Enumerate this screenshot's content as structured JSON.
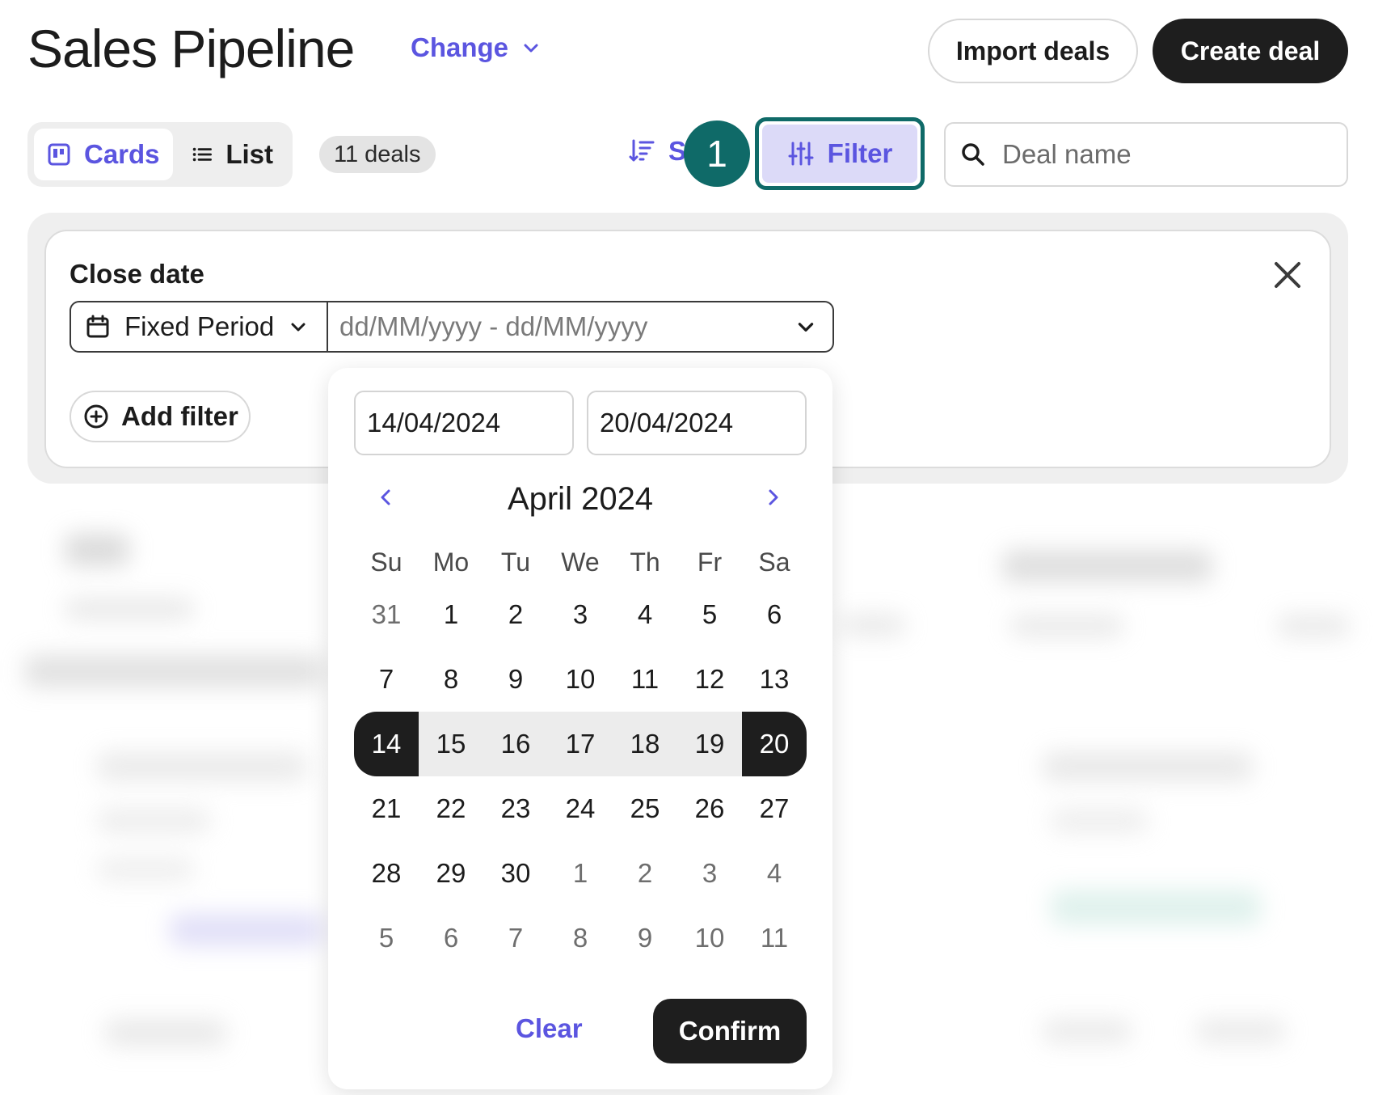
{
  "header": {
    "title": "Sales Pipeline",
    "change_label": "Change",
    "import_label": "Import deals",
    "create_label": "Create deal"
  },
  "toolbar": {
    "views": [
      {
        "label": "Cards",
        "icon": "cards-icon",
        "active": true
      },
      {
        "label": "List",
        "icon": "list-icon",
        "active": false
      }
    ],
    "deals_count": "11 deals",
    "sort_label": "S",
    "step_badge": "1",
    "filter_label": "Filter",
    "search_placeholder": "Deal name"
  },
  "filter_panel": {
    "label": "Close date",
    "period": "Fixed Period",
    "range_placeholder": "dd/MM/yyyy - dd/MM/yyyy",
    "add_filter_label": "Add filter"
  },
  "date_picker": {
    "start_value": "14/04/2024",
    "end_value": "20/04/2024",
    "month_title": "April 2024",
    "weekdays": [
      "Su",
      "Mo",
      "Tu",
      "We",
      "Th",
      "Fr",
      "Sa"
    ],
    "weeks": [
      [
        {
          "d": "31",
          "m": true
        },
        {
          "d": "1"
        },
        {
          "d": "2"
        },
        {
          "d": "3"
        },
        {
          "d": "4"
        },
        {
          "d": "5"
        },
        {
          "d": "6"
        }
      ],
      [
        {
          "d": "7"
        },
        {
          "d": "8"
        },
        {
          "d": "9"
        },
        {
          "d": "10"
        },
        {
          "d": "11"
        },
        {
          "d": "12"
        },
        {
          "d": "13"
        }
      ],
      [
        {
          "d": "14",
          "s": "start"
        },
        {
          "d": "15",
          "s": "in"
        },
        {
          "d": "16",
          "s": "in"
        },
        {
          "d": "17",
          "s": "in"
        },
        {
          "d": "18",
          "s": "in"
        },
        {
          "d": "19",
          "s": "in"
        },
        {
          "d": "20",
          "s": "end"
        }
      ],
      [
        {
          "d": "21"
        },
        {
          "d": "22"
        },
        {
          "d": "23"
        },
        {
          "d": "24"
        },
        {
          "d": "25"
        },
        {
          "d": "26"
        },
        {
          "d": "27"
        }
      ],
      [
        {
          "d": "28"
        },
        {
          "d": "29"
        },
        {
          "d": "30"
        },
        {
          "d": "1",
          "m": true
        },
        {
          "d": "2",
          "m": true
        },
        {
          "d": "3",
          "m": true
        },
        {
          "d": "4",
          "m": true
        }
      ],
      [
        {
          "d": "5",
          "m": true
        },
        {
          "d": "6",
          "m": true
        },
        {
          "d": "7",
          "m": true
        },
        {
          "d": "8",
          "m": true
        },
        {
          "d": "9",
          "m": true
        },
        {
          "d": "10",
          "m": true
        },
        {
          "d": "11",
          "m": true
        }
      ]
    ],
    "clear_label": "Clear",
    "confirm_label": "Confirm"
  },
  "colors": {
    "accent": "#5b55e0",
    "highlight": "#0f6a68",
    "dark": "#1e1e1e"
  }
}
